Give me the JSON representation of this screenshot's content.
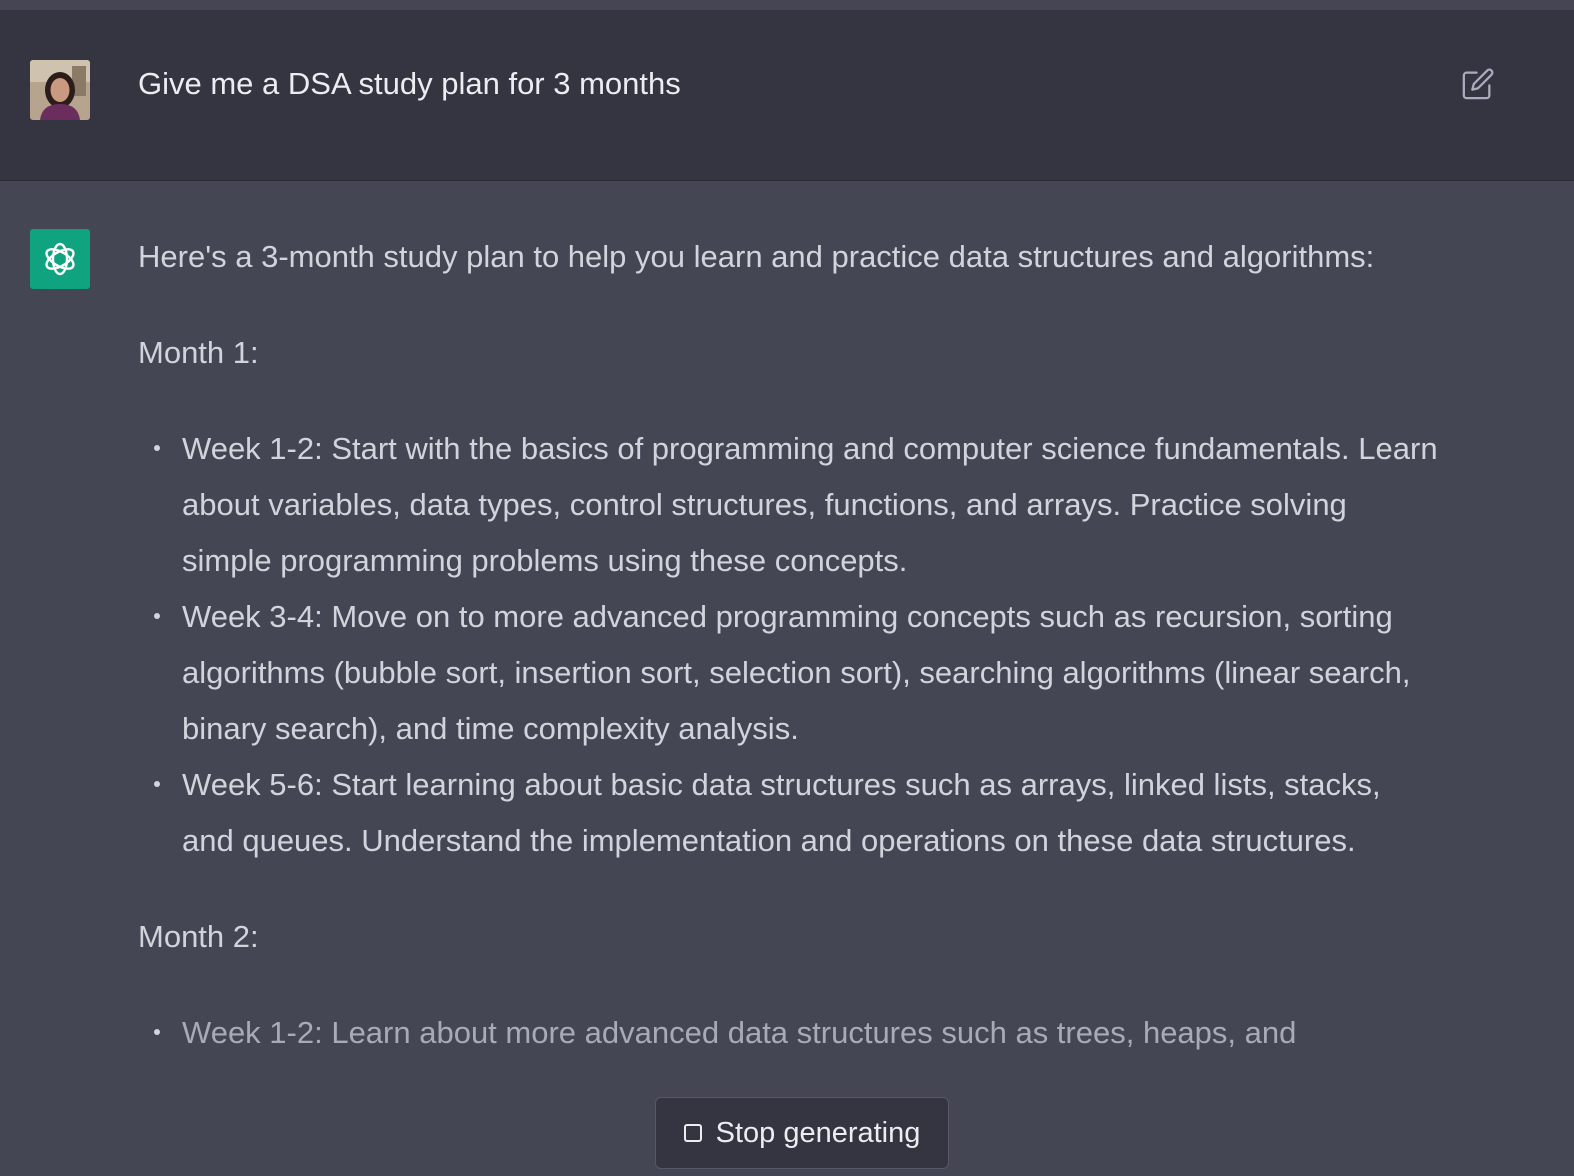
{
  "user_message": {
    "text": "Give me a DSA study plan for 3 months",
    "avatar_icon": "user-photo-avatar",
    "edit_icon": "edit-icon"
  },
  "assistant_message": {
    "avatar_icon": "openai-logo-icon",
    "intro": "Here's a 3-month study plan to help you learn and practice data structures and algorithms:",
    "month1": {
      "heading": "Month 1:",
      "items": [
        "Week 1-2: Start with the basics of programming and computer science fundamentals. Learn about variables, data types, control structures, functions, and arrays. Practice solving simple programming problems using these concepts.",
        "Week 3-4: Move on to more advanced programming concepts such as recursion, sorting algorithms (bubble sort, insertion sort, selection sort), searching algorithms (linear search, binary search), and time complexity analysis.",
        "Week 5-6: Start learning about basic data structures such as arrays, linked lists, stacks, and queues. Understand the implementation and operations on these data structures."
      ]
    },
    "month2": {
      "heading": "Month 2:",
      "items": [
        "Week 1-2: Learn about more advanced data structures such as trees, heaps, and"
      ]
    }
  },
  "controls": {
    "stop_label": "Stop generating",
    "stop_icon": "stop-square-icon"
  },
  "colors": {
    "user_bg": "#343541",
    "assistant_bg": "#444654",
    "logo_green": "#10a37f"
  }
}
